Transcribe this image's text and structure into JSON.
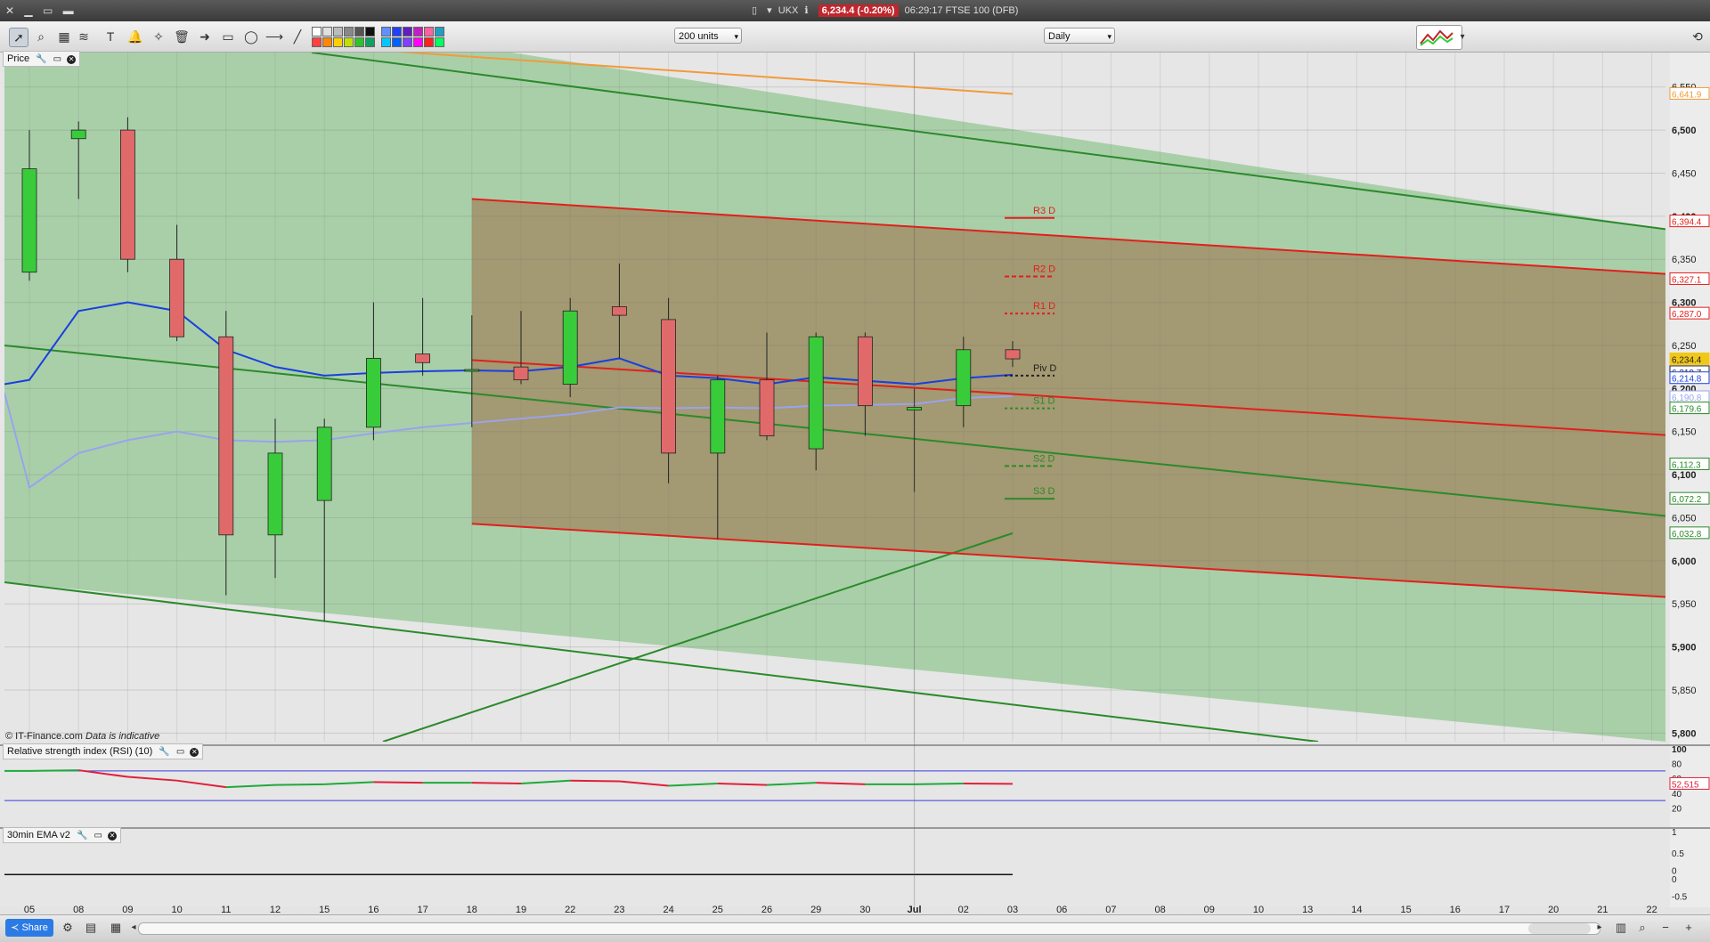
{
  "titlebar": {
    "symbol": "UKX",
    "price_badge": "6,234.4 (-0.20%)",
    "time_and_name": "06:29:17 FTSE 100 (DFB)"
  },
  "toolbar": {
    "units_select": "200 units",
    "period_select": "Daily"
  },
  "panels": {
    "price_label": "Price",
    "rsi_label": "Relative strength index (RSI) (10)",
    "ema_label": "30min EMA v2",
    "watermark": "© IT-Finance.com",
    "watermark_note": "Data is indicative"
  },
  "statusbar": {
    "share_label": "Share"
  },
  "colors": {
    "bull_candle": "#38cc3a",
    "bear_candle": "#e06a6a",
    "green_channel": "#2b8a2b",
    "red_channel": "#e0201c",
    "ma_fast": "#1a3fe0",
    "ma_slow": "#9aa3ee",
    "rsi_up": "#1eaa3a",
    "rsi_down": "#e0203a"
  },
  "chart_data": {
    "type": "candlestick",
    "instrument": "FTSE 100 (DFB)",
    "x_tick_labels": [
      "05",
      "08",
      "09",
      "10",
      "11",
      "12",
      "15",
      "16",
      "17",
      "18",
      "19",
      "22",
      "23",
      "24",
      "25",
      "26",
      "29",
      "30",
      "Jul",
      "02",
      "03",
      "06",
      "07",
      "08",
      "09",
      "10",
      "13",
      "14",
      "15",
      "16",
      "17",
      "20",
      "21",
      "22"
    ],
    "y_tick_labels": [
      "6,550",
      "6,500",
      "6,450",
      "6,400",
      "6,350",
      "6,300",
      "6,250",
      "6,200",
      "6,150",
      "6,100",
      "6,050",
      "6,000",
      "5,950",
      "5,900",
      "5,850",
      "5,800"
    ],
    "ylim": [
      5790,
      6590
    ],
    "candles": [
      {
        "date": "05",
        "open": 6335,
        "high": 6500,
        "low": 6325,
        "close": 6455
      },
      {
        "date": "08",
        "open": 6490,
        "high": 6510,
        "low": 6420,
        "close": 6500
      },
      {
        "date": "09",
        "open": 6500,
        "high": 6515,
        "low": 6335,
        "close": 6350
      },
      {
        "date": "10",
        "open": 6350,
        "high": 6390,
        "low": 6255,
        "close": 6260
      },
      {
        "date": "11",
        "open": 6260,
        "high": 6290,
        "low": 5960,
        "close": 6030
      },
      {
        "date": "12",
        "open": 6030,
        "high": 6165,
        "low": 5980,
        "close": 6125
      },
      {
        "date": "15",
        "open": 6070,
        "high": 6165,
        "low": 5930,
        "close": 6155
      },
      {
        "date": "16",
        "open": 6155,
        "high": 6300,
        "low": 6140,
        "close": 6235
      },
      {
        "date": "17",
        "open": 6240,
        "high": 6305,
        "low": 6215,
        "close": 6230
      },
      {
        "date": "18",
        "open": 6220,
        "high": 6285,
        "low": 6155,
        "close": 6222
      },
      {
        "date": "19",
        "open": 6225,
        "high": 6290,
        "low": 6205,
        "close": 6210
      },
      {
        "date": "22",
        "open": 6205,
        "high": 6305,
        "low": 6190,
        "close": 6290
      },
      {
        "date": "23",
        "open": 6295,
        "high": 6345,
        "low": 6235,
        "close": 6285
      },
      {
        "date": "24",
        "open": 6280,
        "high": 6305,
        "low": 6090,
        "close": 6125
      },
      {
        "date": "25",
        "open": 6125,
        "high": 6215,
        "low": 6025,
        "close": 6210
      },
      {
        "date": "26",
        "open": 6210,
        "high": 6265,
        "low": 6140,
        "close": 6145
      },
      {
        "date": "29",
        "open": 6130,
        "high": 6265,
        "low": 6105,
        "close": 6260
      },
      {
        "date": "30",
        "open": 6260,
        "high": 6265,
        "low": 6145,
        "close": 6180
      },
      {
        "date": "Jul",
        "open": 6175,
        "high": 6200,
        "low": 6080,
        "close": 6178
      },
      {
        "date": "02",
        "open": 6180,
        "high": 6260,
        "low": 6155,
        "close": 6245
      },
      {
        "date": "03",
        "open": 6245,
        "high": 6255,
        "low": 6225,
        "close": 6234.4
      }
    ],
    "ma_fast": [
      6210,
      6290,
      6300,
      6290,
      6245,
      6225,
      6215,
      6218,
      6220,
      6221,
      6220,
      6225,
      6235,
      6215,
      6212,
      6205,
      6213,
      6209,
      6205,
      6212,
      6216
    ],
    "ma_slow": [
      6085,
      6125,
      6140,
      6150,
      6140,
      6138,
      6140,
      6148,
      6155,
      6160,
      6165,
      6170,
      6178,
      6177,
      6178,
      6177,
      6180,
      6181,
      6182,
      6189,
      6191
    ],
    "pivots": [
      {
        "label": "R3 D",
        "value": 6398
      },
      {
        "label": "R2 D",
        "value": 6330
      },
      {
        "label": "R1 D",
        "value": 6287
      },
      {
        "label": "Piv D",
        "value": 6215
      },
      {
        "label": "S1 D",
        "value": 6177
      },
      {
        "label": "S2 D",
        "value": 6110
      },
      {
        "label": "S3 D",
        "value": 6072
      }
    ],
    "right_price_tags": [
      {
        "text": "6,641.9",
        "color": "#f29a3a",
        "value": 6542
      },
      {
        "text": "6,394.4",
        "color": "#e0201c",
        "value": 6394
      },
      {
        "text": "6,327.1",
        "color": "#e0201c",
        "value": 6327
      },
      {
        "text": "6,287.0",
        "color": "#e0201c",
        "value": 6287
      },
      {
        "text": "6,234.4",
        "color": "#f2c818",
        "value": 6234
      },
      {
        "text": "6,219.7",
        "color": "#222222",
        "value": 6219
      },
      {
        "text": "6,214.8",
        "color": "#1a3fe0",
        "value": 6212
      },
      {
        "text": "6,190.8",
        "color": "#9aa3ee",
        "value": 6190
      },
      {
        "text": "6,179.6",
        "color": "#2b8a2b",
        "value": 6177
      },
      {
        "text": "6,112.3",
        "color": "#2b8a2b",
        "value": 6112
      },
      {
        "text": "6,072.2",
        "color": "#2b8a2b",
        "value": 6072
      },
      {
        "text": "6,032.8",
        "color": "#2b8a2b",
        "value": 6032
      }
    ],
    "rsi": {
      "period": 10,
      "values": [
        70,
        71,
        62,
        57,
        48,
        51,
        52,
        55,
        54,
        54,
        53,
        57,
        56,
        50,
        53,
        51,
        54,
        52,
        52,
        53,
        52.5
      ],
      "levels": [
        70,
        30
      ],
      "y_tick_labels": [
        "100",
        "80",
        "60",
        "40",
        "20"
      ],
      "last_label": "52,515",
      "ylim": [
        0,
        100
      ]
    },
    "ema_panel": {
      "y_tick_labels": [
        "1",
        "0.5",
        "0",
        "0",
        "-0.5"
      ],
      "ylim": [
        -0.7,
        1
      ]
    }
  }
}
